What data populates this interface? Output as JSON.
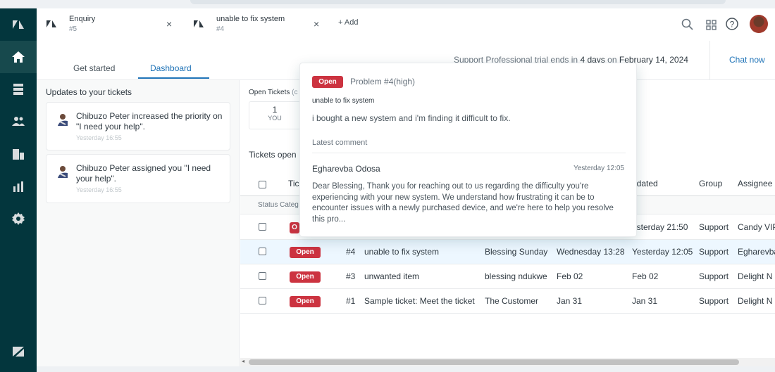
{
  "header": {
    "tabs": [
      {
        "name": "Enquiry",
        "number": "#5",
        "close": "×"
      },
      {
        "name": "unable to fix system",
        "number": "#4",
        "close": "×"
      }
    ],
    "add_label": "+ Add",
    "icons": [
      "search-icon",
      "apps-grid-icon",
      "help-icon",
      "user-avatar"
    ]
  },
  "nav": {
    "items": [
      "zendesk-logo-icon",
      "home-icon",
      "views-icon",
      "customers-icon",
      "organizations-icon",
      "reporting-icon",
      "admin-gear-icon",
      "zendesk-z-icon"
    ]
  },
  "subheader": {
    "tabs": [
      "Get started",
      "Dashboard"
    ],
    "active_tab": "Dashboard",
    "trial_prefix": "Support Professional trial ends in",
    "trial_days": "4 days",
    "trial_mid": "on",
    "trial_date": "February 14, 2024",
    "chat_now": "Chat now"
  },
  "updates": {
    "title": "Updates to your tickets",
    "items": [
      {
        "actor": "Chibuzo Peter",
        "action": "increased the priority",
        "rest": "on \"I need your help\".",
        "time": "Yesterday 16:55"
      },
      {
        "actor": "Chibuzo Peter",
        "action": "assigned",
        "rest": "you \"I need your help\".",
        "time": "Yesterday 16:55"
      }
    ]
  },
  "main": {
    "open_tickets_label": "Open Tickets",
    "open_tickets_suffix": "(c",
    "you_count": "1",
    "you_label": "YOU",
    "tickets_open_title": "Tickets open",
    "columns": {
      "ticket": "Tic",
      "updated": "pdated",
      "group": "Group",
      "assignee": "Assignee"
    },
    "status_category": "Status Categ",
    "rows": [
      {
        "status": "O",
        "id": "",
        "subject": "",
        "requester": "",
        "requested": "",
        "updated": "esterday 21:50",
        "group": "Support",
        "assignee": "Candy VIP"
      },
      {
        "status": "Open",
        "id": "#4",
        "subject": "unable to fix system",
        "requester": "Blessing Sunday",
        "requested": "Wednesday 13:28",
        "updated": "Yesterday 12:05",
        "group": "Support",
        "assignee": "Egharevba"
      },
      {
        "status": "Open",
        "id": "#3",
        "subject": "unwanted item",
        "requester": "blessing ndukwe",
        "requested": "Feb 02",
        "updated": "Feb 02",
        "group": "Support",
        "assignee": "Delight N"
      },
      {
        "status": "Open",
        "id": "#1",
        "subject": "Sample ticket: Meet the ticket",
        "requester": "The Customer",
        "requested": "Jan 31",
        "updated": "Jan 31",
        "group": "Support",
        "assignee": "Delight N"
      }
    ]
  },
  "popover": {
    "status": "Open",
    "title": "Problem #4(high)",
    "subject": "unable to fix system",
    "description": "i bought a new system and i'm finding it difficult to fix.",
    "latest_label": "Latest comment",
    "author": "Egharevba Odosa",
    "time": "Yesterday 12:05",
    "body": "Dear Blessing, Thank you for reaching out to us regarding the difficulty you're experiencing with your new system. We understand how frustrating it can be to encounter issues with a newly purchased device, and we're here to help you resolve this pro..."
  },
  "colors": {
    "nav_bg": "#03363d",
    "accent": "#1f73b7",
    "open_badge": "#cc3340"
  }
}
